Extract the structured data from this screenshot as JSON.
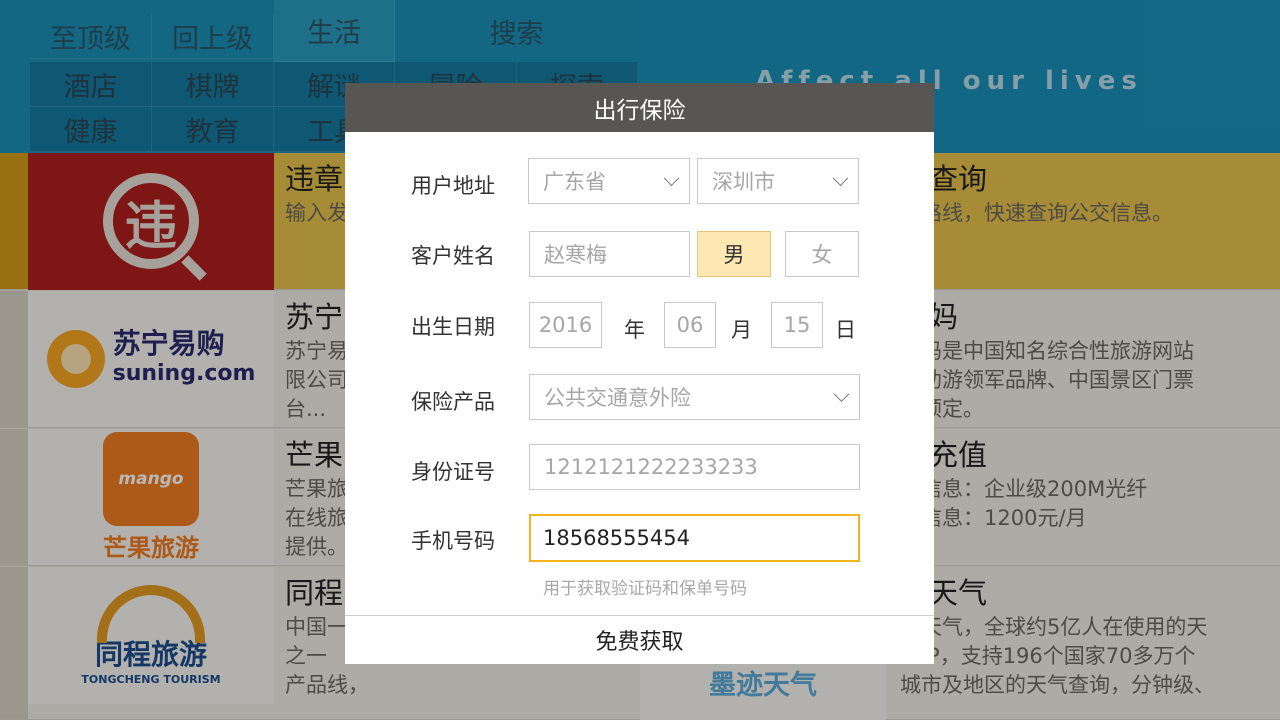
{
  "nav": {
    "row1": [
      "至顶级",
      "回上级",
      "生活"
    ],
    "search": "搜索",
    "row2": [
      "酒店",
      "棋牌",
      "解谜",
      "冒险",
      "探索"
    ],
    "row3": [
      "健康",
      "教育",
      "工具"
    ]
  },
  "header": {
    "slogan": "Affect all our lives"
  },
  "list": {
    "left": [
      {
        "title": "违章",
        "desc": "输入发"
      },
      {
        "title": "苏宁",
        "desc": "苏宁易\n限公司\n台..."
      },
      {
        "title": "芒果",
        "desc": "芒果旅\n在线旅\n提供。"
      },
      {
        "title": "同程",
        "desc": "中国一\n之一\n产品线，"
      }
    ],
    "right": [
      {
        "title": "交查询",
        "desc": "入路线，快速查询公交信息。"
      },
      {
        "title": "妈妈",
        "desc": "妈妈是中国知名综合性旅游网站\n自助游领军品牌、中国景区门票\n线预定。"
      },
      {
        "title": "费充值",
        "desc": "餐信息：企业级200M光纤\n用信息：1200元/月"
      },
      {
        "title": "迹天气",
        "desc": "迹天气，全球约5亿人在使用的天\nAPP，支持196个国家70多万个\n城市及地区的天气查询，分钟级、"
      }
    ],
    "logos": {
      "wei": "违",
      "suning_cn": "苏宁易购",
      "suning_en": "suning.com",
      "mango_en": "mango",
      "mango_cn": "芒果旅游",
      "tongcheng_cn": "同程旅游",
      "tongcheng_en": "TONGCHENG TOURISM",
      "moji": "墨迹天气"
    }
  },
  "dialog": {
    "title": "出行保险",
    "address_label": "用户地址",
    "province": "广东省",
    "city": "深圳市",
    "name_label": "客户姓名",
    "name_placeholder": "赵寒梅",
    "gender_male": "男",
    "gender_female": "女",
    "birth_label": "出生日期",
    "birth_year": "2016",
    "year_unit": "年",
    "birth_month": "06",
    "month_unit": "月",
    "birth_day": "15",
    "day_unit": "日",
    "product_label": "保险产品",
    "product": "公共交通意外险",
    "id_label": "身份证号",
    "id_placeholder": "1212121222233233",
    "phone_label": "手机号码",
    "phone_value": "18568555454",
    "phone_hint": "用于获取验证码和保单号码",
    "submit": "免费获取"
  },
  "colors": {
    "header_bg": "#1b8fb4",
    "dialog_title_bg": "#585653",
    "male_selected_bg": "#fde8b4",
    "focus_border": "#f2b31d"
  }
}
